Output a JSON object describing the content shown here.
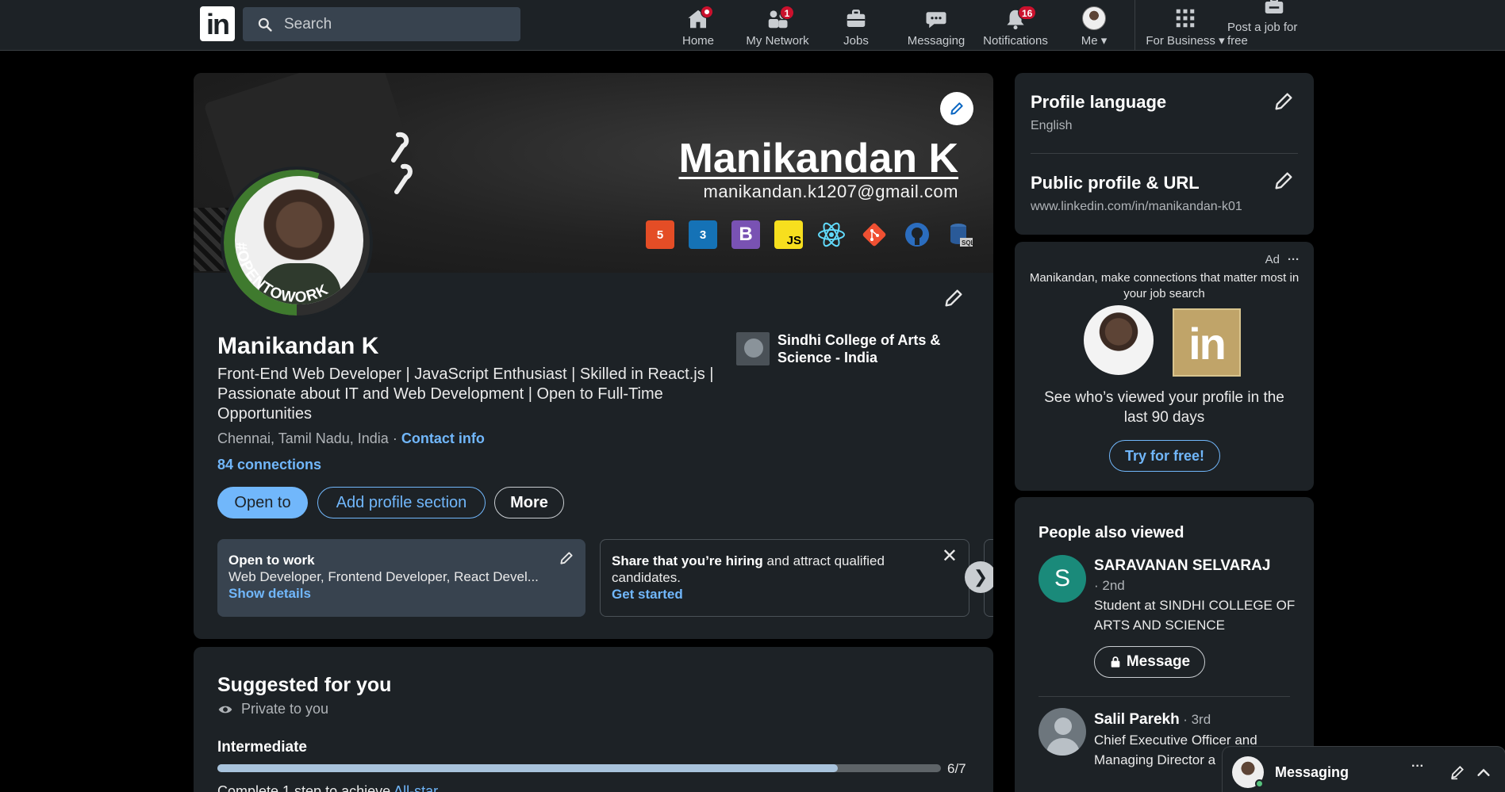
{
  "nav": {
    "search_placeholder": "Search",
    "items": [
      {
        "label": "Home",
        "icon": "home-icon",
        "badge": ""
      },
      {
        "label": "My Network",
        "icon": "people-icon",
        "badge": "1"
      },
      {
        "label": "Jobs",
        "icon": "briefcase-icon",
        "badge": ""
      },
      {
        "label": "Messaging",
        "icon": "chat-icon",
        "badge": ""
      },
      {
        "label": "Notifications",
        "icon": "bell-icon",
        "badge": "16"
      },
      {
        "label": "Me",
        "icon": "avatar-icon",
        "badge": ""
      },
      {
        "label": "For Business",
        "icon": "grid-icon",
        "badge": ""
      },
      {
        "label": "Post a job for free",
        "icon": "job-post-icon",
        "badge": ""
      }
    ]
  },
  "profile": {
    "banner_name": "Manikandan K",
    "banner_email": "manikandan.k1207@gmail.com",
    "tech_icons": [
      "html5",
      "css3",
      "bootstrap",
      "javascript",
      "react",
      "git",
      "github",
      "sql"
    ],
    "open_to_work_tag": "#OPENTOWORK",
    "name": "Manikandan K",
    "headline": "Front-End Web Developer | JavaScript Enthusiast | Skilled in React.js | Passionate about IT and Web Development | Open to Full-Time Opportunities",
    "location": "Chennai, Tamil Nadu, India",
    "separator": "·",
    "contact_info": "Contact info",
    "connections": "84 connections",
    "education": "Sindhi College of Arts & Science - India",
    "buttons": {
      "open_to": "Open to",
      "add_section": "Add profile section",
      "more": "More"
    },
    "open_to_work": {
      "title": "Open to work",
      "roles": "Web Developer, Frontend Developer, React Devel...",
      "link": "Show details"
    },
    "hiring": {
      "bold": "Share that you’re hiring",
      "rest": " and attract qualified candidates.",
      "link": "Get started"
    }
  },
  "suggested": {
    "title": "Suggested for you",
    "private": "Private to you",
    "level": "Intermediate",
    "progress_label": "6/7",
    "progress_fraction": 0.857,
    "hint_prefix": "Complete 1 step to achieve ",
    "hint_link": "All-star"
  },
  "side": {
    "lang_title": "Profile language",
    "lang_value": "English",
    "url_title": "Public profile & URL",
    "url_value": "www.linkedin.com/in/manikandan-k01",
    "ad": {
      "label": "Ad",
      "text": "Manikandan, make connections that matter most in your job search",
      "body": "See who’s viewed your profile in the last 90 days",
      "cta": "Try for free!"
    },
    "people": {
      "title": "People also viewed",
      "list": [
        {
          "initial": "S",
          "name": "SARAVANAN SELVARAJ",
          "degree": "· 2nd",
          "headline": "Student at SINDHI COLLEGE OF ARTS AND SCIENCE",
          "action": "Message"
        },
        {
          "initial": "",
          "name": "Salil Parekh",
          "degree": "· 3rd",
          "headline": "Chief Executive Officer and Managing Director a"
        }
      ]
    }
  },
  "messaging": {
    "label": "Messaging"
  }
}
